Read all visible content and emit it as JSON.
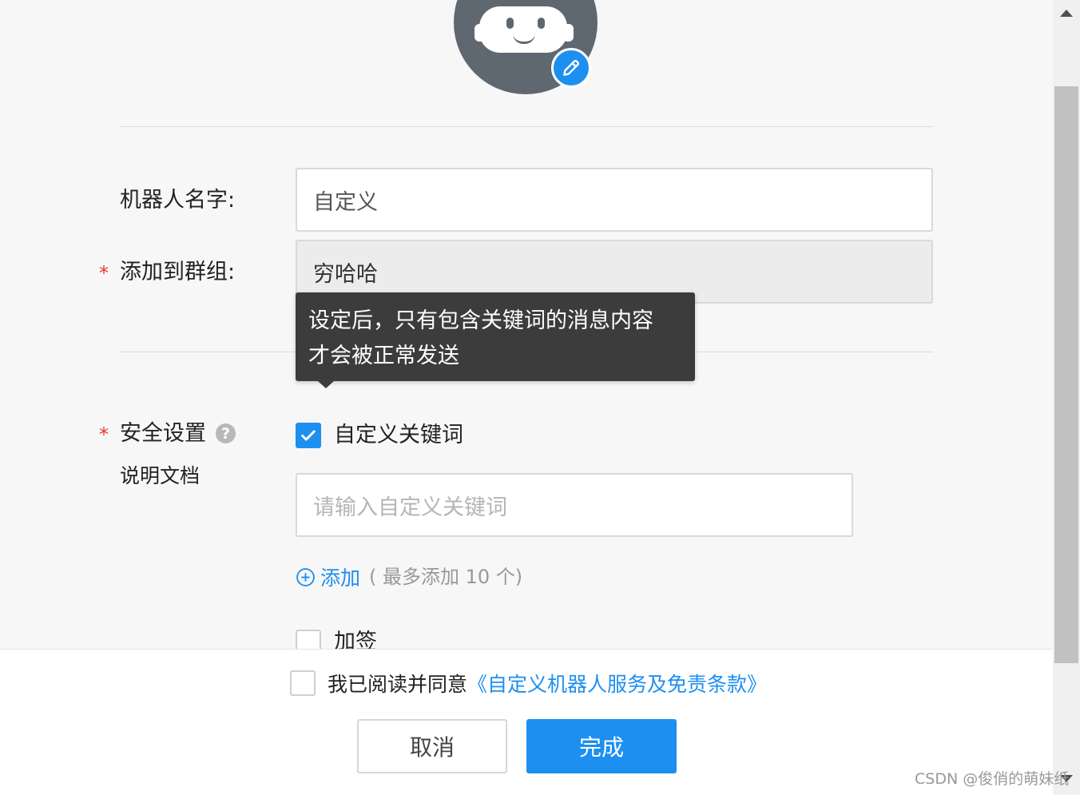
{
  "form": {
    "robot_name_label": "机器人名字:",
    "robot_name_value": "自定义",
    "group_required_mark": "*",
    "group_label": "添加到群组:",
    "group_value": "穷哈哈",
    "tooltip_line1": "设定后，只有包含关键词的消息内容",
    "tooltip_line2": "才会被正常发送",
    "security_required_mark": "*",
    "security_label": "安全设置",
    "help_icon_glyph": "?",
    "docs_link": "说明文档",
    "keyword_checkbox_label": "自定义关键词",
    "keyword_checked": true,
    "keyword_placeholder": "请输入自定义关键词",
    "add_link": "添加",
    "add_hint": "( 最多添加 10 个)",
    "sign_checkbox_label": "加签",
    "sign_checked": false
  },
  "footer": {
    "agree_text": "我已阅读并同意",
    "agree_link": "《自定义机器人服务及免责条款》",
    "agree_checked": false,
    "cancel_label": "取消",
    "confirm_label": "完成"
  },
  "watermark": "CSDN @俊俏的萌妹纸",
  "colors": {
    "accent": "#1d8ff0",
    "required": "#e53935",
    "tooltip_bg": "#3c3c3c",
    "avatar_bg": "#5f6770"
  },
  "icons": {
    "avatar": "robot-avatar-icon",
    "edit": "pencil-icon",
    "help": "question-circle-icon",
    "add": "plus-circle-icon",
    "check": "check-icon"
  }
}
